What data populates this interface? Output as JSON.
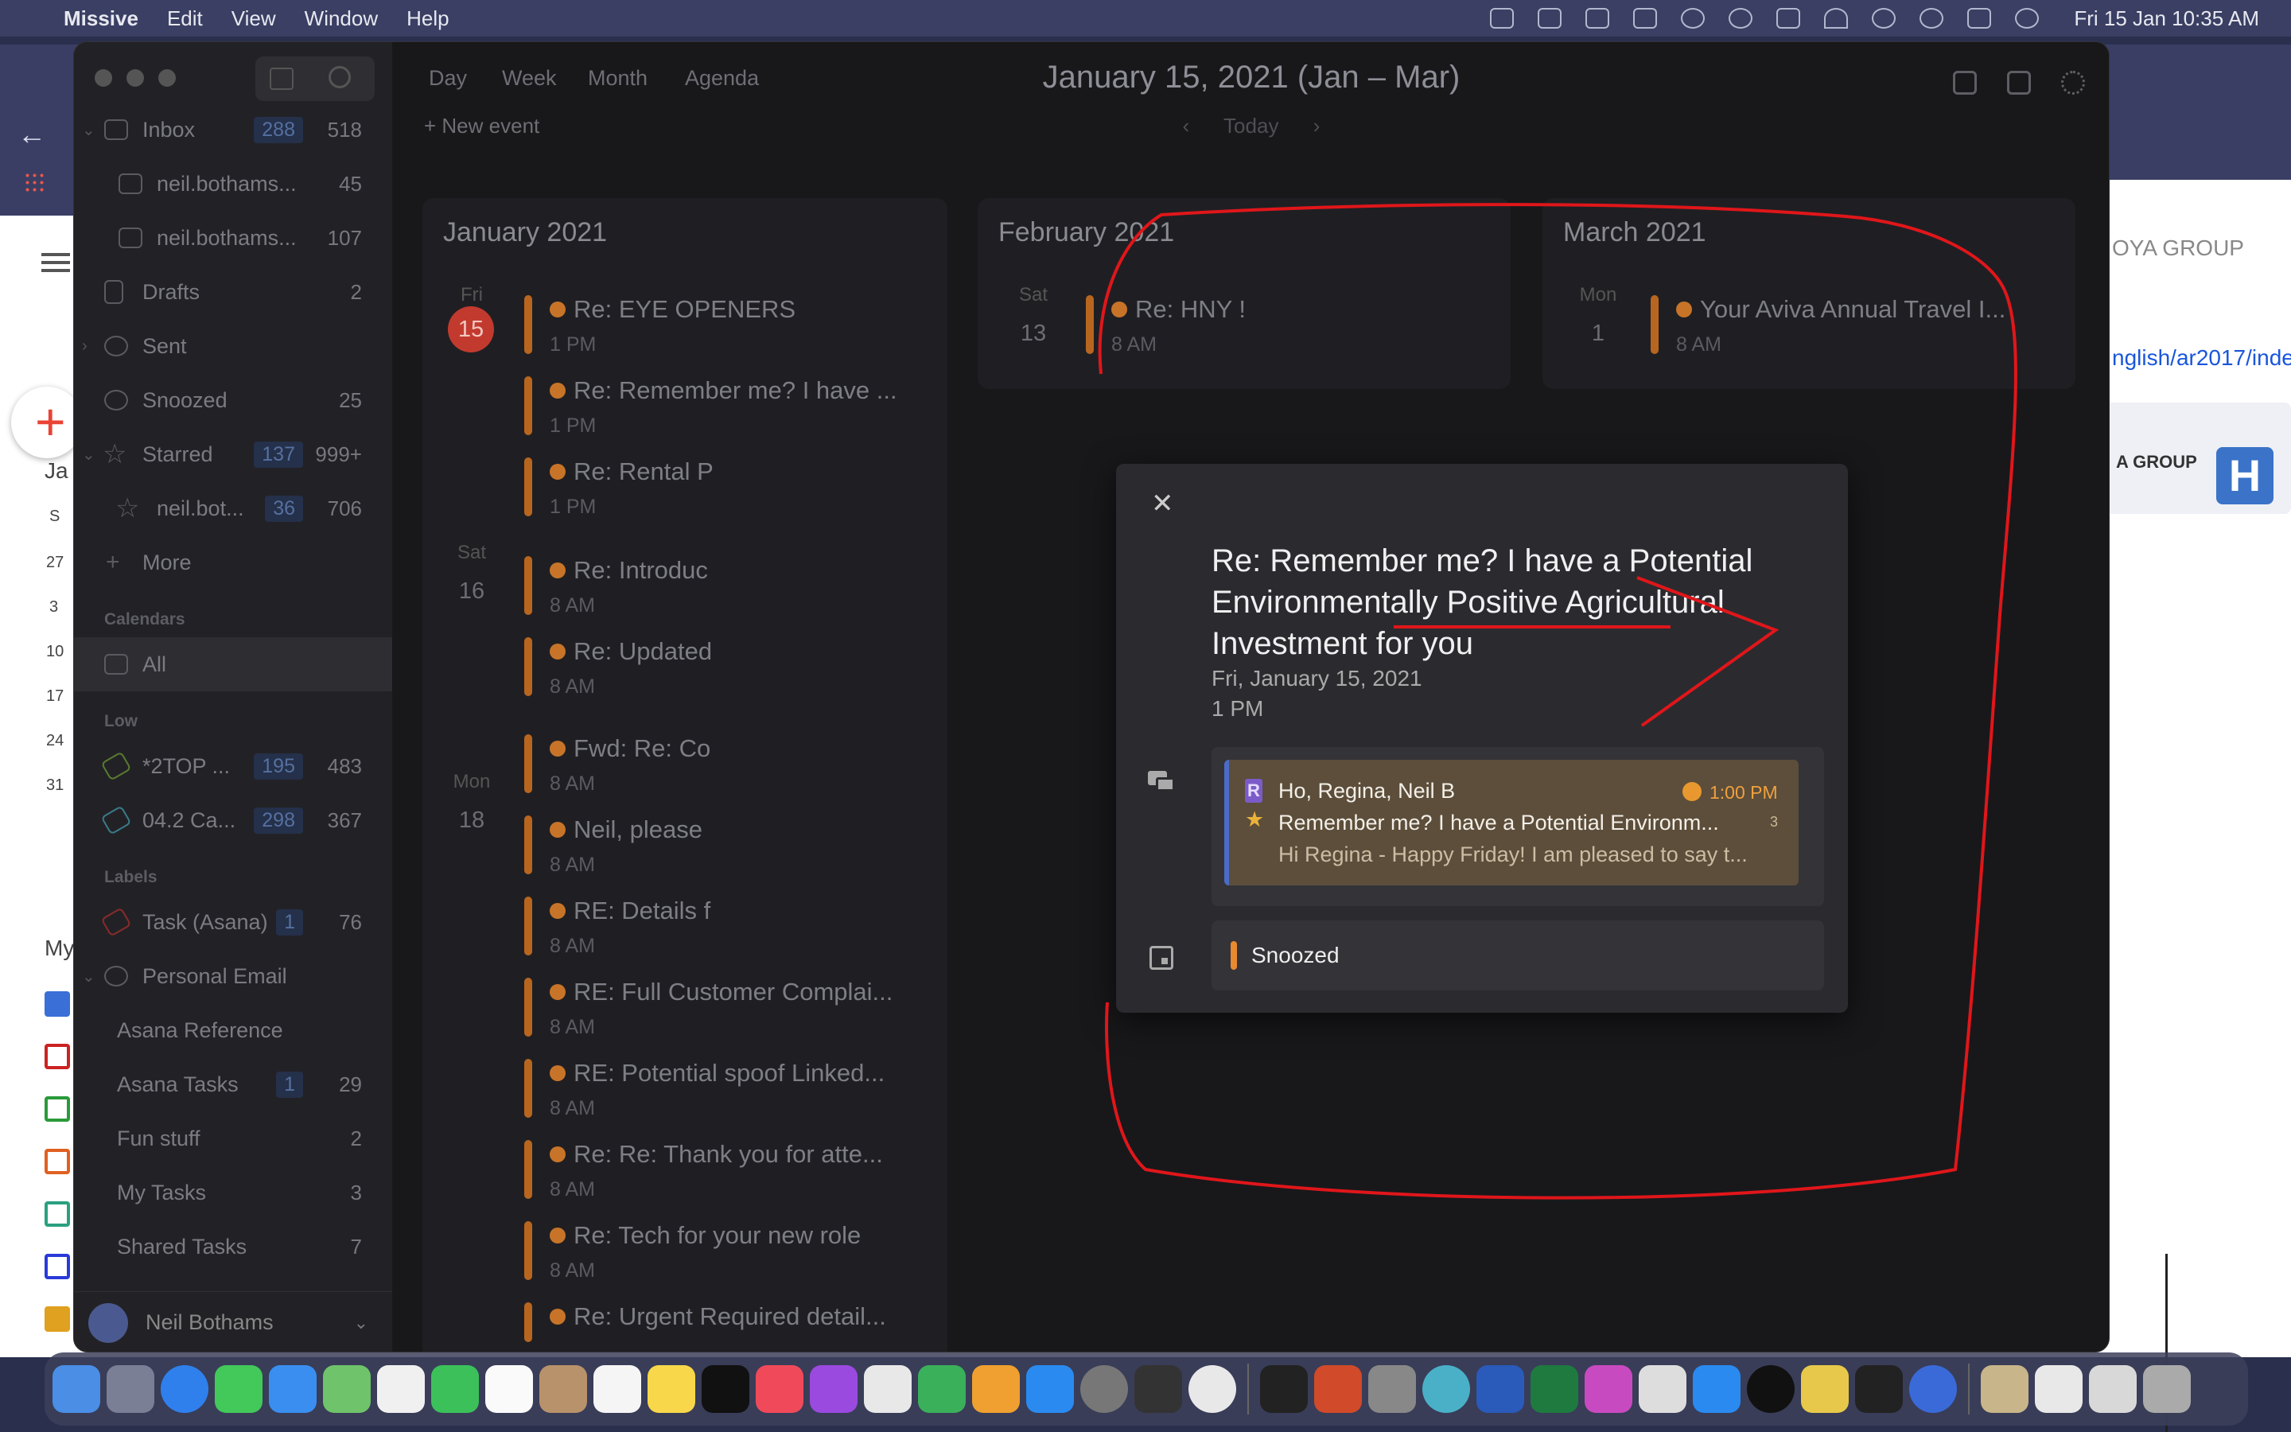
{
  "menubar": {
    "app_name": "Missive",
    "items": [
      "Edit",
      "View",
      "Window",
      "Help"
    ],
    "clock": "Fri 15 Jan  10:35 AM"
  },
  "background_window": {
    "group_text": "OYA GROUP",
    "link_text": "nglish/ar2017/inde",
    "card_text": "A GROUP",
    "card_logo": "H",
    "mini_month_label": "Ja",
    "mini_day_header": "S",
    "mini_days": [
      "27",
      "3",
      "10",
      "17",
      "24",
      "31"
    ],
    "my_label": "My"
  },
  "sidebar": {
    "items": [
      {
        "label": "Inbox",
        "c1": "288",
        "c2": "518"
      },
      {
        "label": "neil.bothams...",
        "c1": "",
        "c2": "45"
      },
      {
        "label": "neil.bothams...",
        "c1": "",
        "c2": "107"
      },
      {
        "label": "Drafts",
        "c1": "",
        "c2": "2"
      },
      {
        "label": "Sent",
        "c1": "",
        "c2": ""
      },
      {
        "label": "Snoozed",
        "c1": "",
        "c2": "25"
      },
      {
        "label": "Starred",
        "c1": "137",
        "c2": "999+"
      },
      {
        "label": "neil.bot...",
        "c1": "36",
        "c2": "706"
      },
      {
        "label": "More",
        "c1": "",
        "c2": ""
      }
    ],
    "calendars_head": "Calendars",
    "calendars_all": "All",
    "low_head": "Low",
    "low_items": [
      {
        "label": "*2TOP ...",
        "c1": "195",
        "c2": "483"
      },
      {
        "label": "04.2 Ca...",
        "c1": "298",
        "c2": "367"
      }
    ],
    "labels_head": "Labels",
    "label_items": [
      {
        "label": "Task (Asana)",
        "c1": "1",
        "c2": "76"
      },
      {
        "label": "Personal Email",
        "c1": "",
        "c2": ""
      },
      {
        "label": "Asana Reference",
        "c1": "",
        "c2": ""
      },
      {
        "label": "Asana Tasks",
        "c1": "1",
        "c2": "29"
      },
      {
        "label": "Fun stuff",
        "c1": "",
        "c2": "2"
      },
      {
        "label": "My Tasks",
        "c1": "",
        "c2": "3"
      },
      {
        "label": "Shared Tasks",
        "c1": "",
        "c2": "7"
      }
    ],
    "user_name": "Neil Bothams"
  },
  "calendar": {
    "tabs": [
      "Day",
      "Week",
      "Month",
      "Agenda"
    ],
    "title": "January 15, 2021 (Jan – Mar)",
    "new_event": "+ New event",
    "today_nav": "‹      Today      ›",
    "months": [
      {
        "name": "January 2021",
        "days": [
          {
            "dow": "Fri",
            "num": "15"
          },
          {
            "dow": "Sat",
            "num": "16"
          },
          {
            "dow": "Mon",
            "num": "18"
          }
        ],
        "events": [
          {
            "title": "Re: EYE OPENERS",
            "time": "1 PM"
          },
          {
            "title": "Re: Remember me? I have ...",
            "time": "1 PM"
          },
          {
            "title": "Re: Rental P",
            "time": "1 PM"
          },
          {
            "title": "Re: Introduc",
            "time": "8 AM"
          },
          {
            "title": "Re: Updated",
            "time": "8 AM"
          },
          {
            "title": "Fwd: Re: Co",
            "time": "8 AM"
          },
          {
            "title": "Neil, please",
            "time": "8 AM"
          },
          {
            "title": "RE: Details f",
            "time": "8 AM"
          },
          {
            "title": "RE: Full Customer Complai...",
            "time": "8 AM"
          },
          {
            "title": "RE: Potential spoof Linked...",
            "time": "8 AM"
          },
          {
            "title": "Re: Re: Thank you for atte...",
            "time": "8 AM"
          },
          {
            "title": "Re: Tech for your new role",
            "time": "8 AM"
          },
          {
            "title": "Re: Urgent Required detail...",
            "time": ""
          }
        ]
      },
      {
        "name": "February 2021",
        "days": [
          {
            "dow": "Sat",
            "num": "13"
          }
        ],
        "events": [
          {
            "title": "Re: HNY !",
            "time": "8 AM"
          }
        ]
      },
      {
        "name": "March 2021",
        "days": [
          {
            "dow": "Mon",
            "num": "1"
          }
        ],
        "events": [
          {
            "title": "Your Aviva Annual Travel I...",
            "time": "8 AM"
          }
        ]
      }
    ]
  },
  "modal": {
    "close": "✕",
    "title": "Re: Remember me? I have a Potential Environmentally Positive Agricultural Investment for you",
    "date": "Fri, January 15, 2021",
    "time": "1 PM",
    "conversation": {
      "badge": "R",
      "from": "Ho, Regina, Neil B",
      "time": "1:00 PM",
      "subject": "Remember me? I have a Potential Environm...",
      "count": "3",
      "preview": "Hi Regina - Happy Friday! I am pleased to say t..."
    },
    "status": "Snoozed"
  },
  "colors": {
    "accent_orange": "#e88a2e",
    "today_red": "#c23a2e",
    "annotation_red": "#e0161a"
  }
}
